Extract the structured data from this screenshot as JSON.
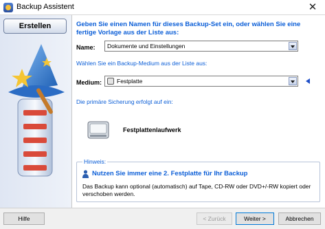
{
  "window": {
    "title": "Backup Assistent",
    "close_glyph": "✕"
  },
  "sidebar": {
    "tab_label": "Erstellen"
  },
  "main": {
    "headline": "Geben Sie einen Namen für dieses Backup-Set ein, oder wählen Sie eine fertige Vorlage aus der Liste aus:",
    "name_label": "Name:",
    "name_value": "Dokumente und Einstellungen",
    "medium_prompt": "Wählen Sie ein Backup-Medium aus der Liste aus:",
    "medium_label": "Medium:",
    "medium_value": "Festplatte",
    "primary_backup_text": "Die primäre Sicherung erfolgt auf ein:",
    "drive_label": "Festplattenlaufwerk"
  },
  "hint": {
    "title": "Hinweis:",
    "heading": "Nutzen Sie immer eine 2. Festplatte für Ihr Backup",
    "body": "Das Backup kann optional (automatisch) auf Tape, CD-RW oder DVD+/-RW kopiert oder verschoben werden."
  },
  "footer": {
    "help_label": "Hilfe",
    "back_label": "< Zurück",
    "next_label": "Weiter >",
    "cancel_label": "Abbrechen"
  },
  "colors": {
    "accent": "#0b5ed7",
    "sidebar": "#dfe6f3"
  },
  "icons": [
    "app-icon",
    "close-icon",
    "wizard-hat-icon",
    "hard-drive-icon",
    "user-icon",
    "arrow-left-icon"
  ]
}
